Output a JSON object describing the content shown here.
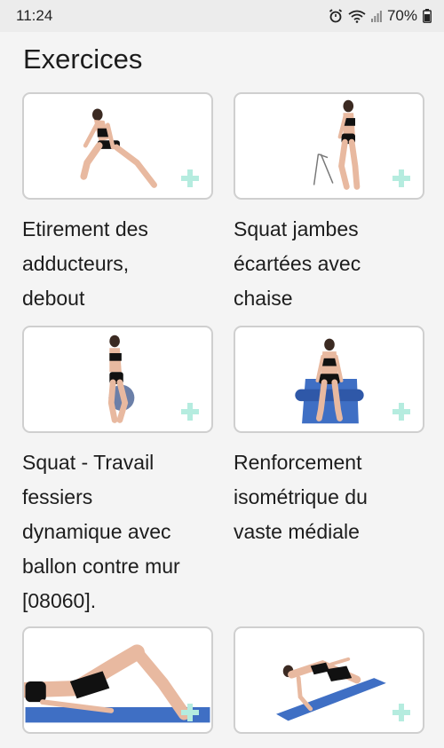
{
  "status_bar": {
    "time": "11:24",
    "battery": "70%",
    "icons": [
      "alarm-icon",
      "wifi-icon",
      "signal-icon",
      "battery-icon"
    ]
  },
  "page": {
    "title": "Exercices"
  },
  "exercises": [
    {
      "label": "Etirement des\nadducteurs,\ndebout",
      "image": "standing-adductor-stretch",
      "action_icon": "plus-icon"
    },
    {
      "label": "Squat jambes\nécartées avec\nchaise",
      "image": "wide-squat-with-chair",
      "action_icon": "plus-icon"
    },
    {
      "label": "Squat - Travail\nfessiers\ndynamique avec\nballon contre mur\n[08060].",
      "image": "wall-ball-squat",
      "action_icon": "plus-icon"
    },
    {
      "label": "Renforcement\nisométrique du\nvaste médiale",
      "image": "seated-vastus-medialis-foam-roller",
      "action_icon": "plus-icon"
    },
    {
      "label": "",
      "image": "glute-bridge-on-mat",
      "action_icon": "plus-icon"
    },
    {
      "label": "",
      "image": "side-plank-hip-on-mat",
      "action_icon": "plus-icon"
    }
  ],
  "colors": {
    "background": "#f4f4f4",
    "card_border": "#cfcfcf",
    "plus_accent": "#b5ecdf",
    "mat_blue": "#3f6fc4"
  }
}
